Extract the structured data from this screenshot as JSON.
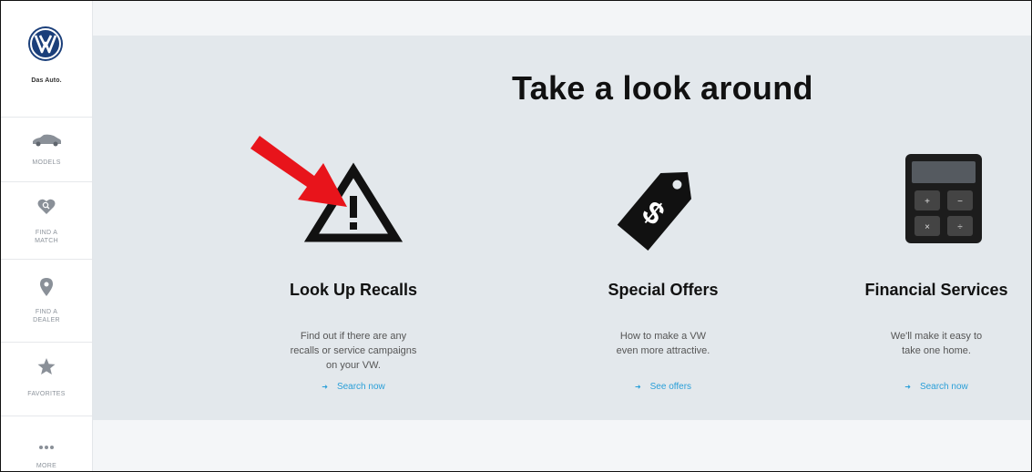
{
  "brand": {
    "tagline": "Das Auto."
  },
  "sidebar": {
    "items": [
      {
        "label": "MODELS",
        "icon": "car-icon"
      },
      {
        "label": "FIND A\nMATCH",
        "icon": "heart-search-icon"
      },
      {
        "label": "FIND A\nDEALER",
        "icon": "location-pin-icon"
      },
      {
        "label": "FAVORITES",
        "icon": "star-icon"
      },
      {
        "label": "MORE",
        "icon": "more-dots-icon"
      }
    ]
  },
  "main": {
    "title": "Take a look around",
    "cards": [
      {
        "title": "Look Up Recalls",
        "desc": "Find out if there are any recalls or service campaigns on your VW.",
        "link": "Search now",
        "icon": "warning-triangle-icon"
      },
      {
        "title": "Special Offers",
        "desc": "How to make a VW even more attractive.",
        "link": "See offers",
        "icon": "price-tag-icon"
      },
      {
        "title": "Financial Services",
        "desc": "We'll make it easy to take one home.",
        "link": "Search now",
        "icon": "calculator-icon"
      }
    ]
  },
  "colors": {
    "link": "#2a9fd8",
    "hero_bg": "#e3e8ec",
    "annotation_arrow": "#e8141b"
  }
}
